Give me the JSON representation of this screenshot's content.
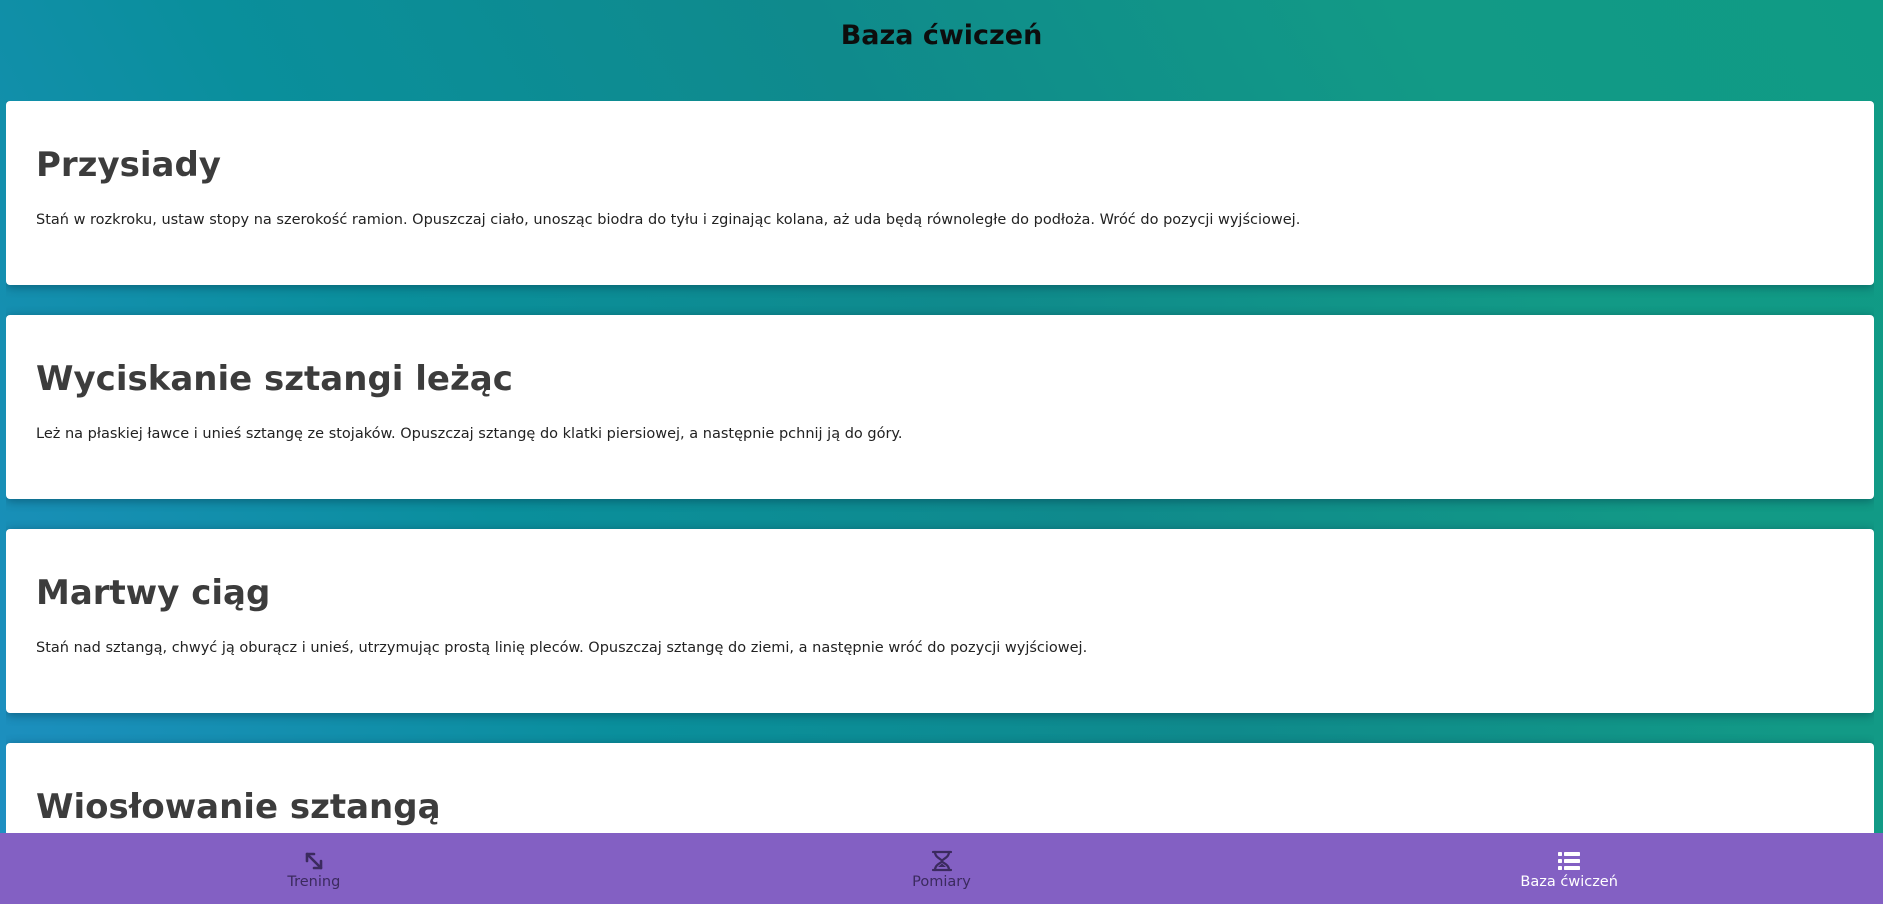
{
  "header": {
    "title": "Baza ćwiczeń"
  },
  "exercises": [
    {
      "name": "Przysiady",
      "description": "Stań w rozkroku, ustaw stopy na szerokość ramion. Opuszczaj ciało, unosząc biodra do tyłu i zginając kolana, aż uda będą równoległe do podłoża. Wróć do pozycji wyjściowej."
    },
    {
      "name": "Wyciskanie sztangi leżąc",
      "description": "Leż na płaskiej ławce i unieś sztangę ze stojaków. Opuszczaj sztangę do klatki piersiowej, a następnie pchnij ją do góry."
    },
    {
      "name": "Martwy ciąg",
      "description": "Stań nad sztangą, chwyć ją oburącz i unieś, utrzymując prostą linię pleców. Opuszczaj sztangę do ziemi, a następnie wróć do pozycji wyjściowej."
    },
    {
      "name": "Wiosłowanie sztangą",
      "description": ""
    }
  ],
  "nav": {
    "items": [
      {
        "label": "Trening",
        "icon": "resize-arrows-icon",
        "active": false
      },
      {
        "label": "Pomiary",
        "icon": "hourglass-scale-icon",
        "active": false
      },
      {
        "label": "Baza ćwiczeń",
        "icon": "list-icon",
        "active": true
      }
    ]
  },
  "colors": {
    "nav_background": "#8360c3",
    "nav_active_label": "#ffffff",
    "nav_inactive_label": "#3b2a5e",
    "card_background": "#ffffff",
    "card_title": "#3c3c3c"
  }
}
